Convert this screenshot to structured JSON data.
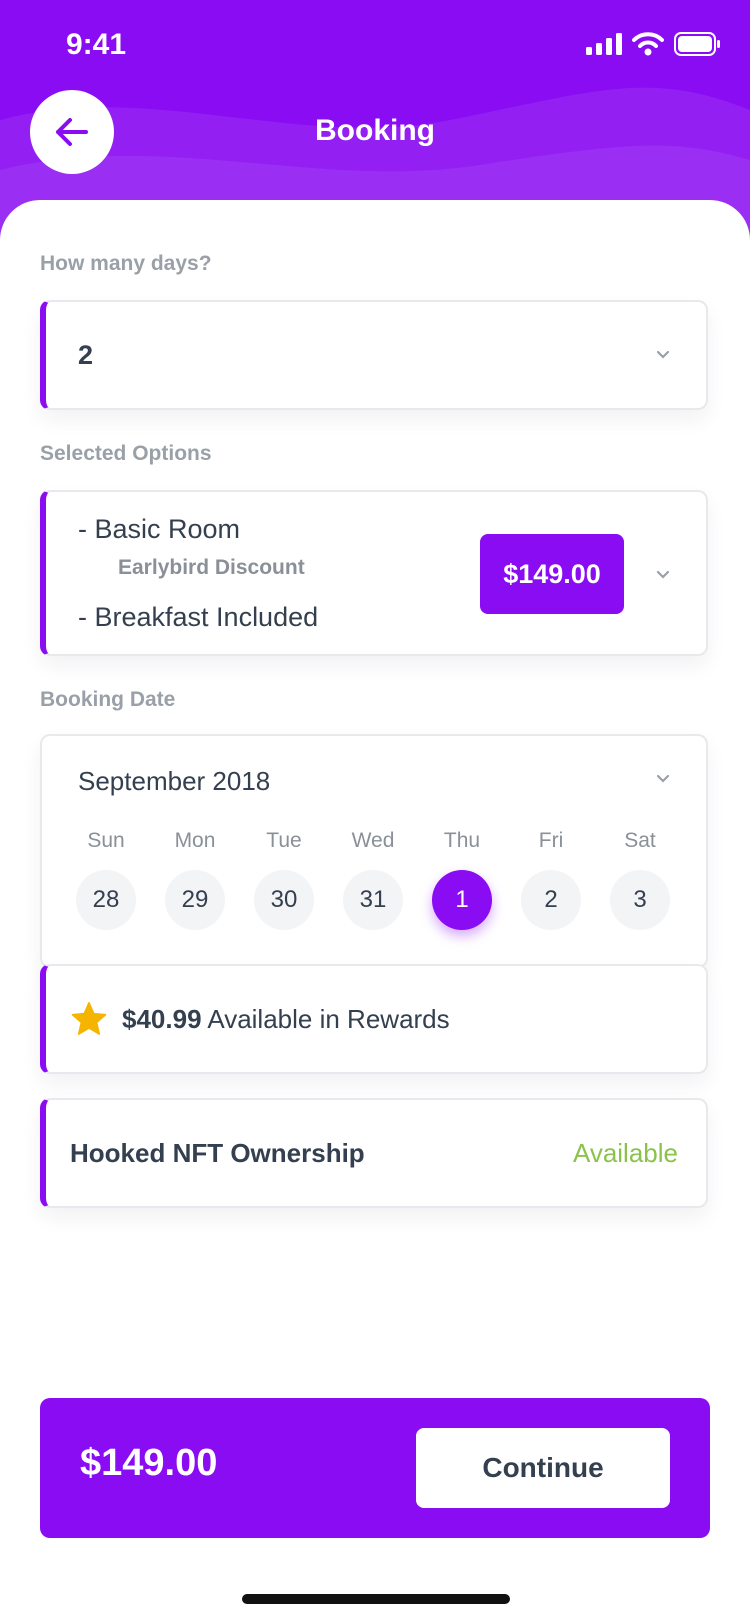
{
  "status_bar": {
    "time": "9:41",
    "icons": [
      "signal-icon",
      "wifi-icon",
      "battery-icon"
    ]
  },
  "header": {
    "title": "Booking",
    "back_icon": "arrow-left-icon"
  },
  "days": {
    "label": "How many days?",
    "value": "2"
  },
  "options": {
    "label": "Selected Options",
    "line1": "- Basic Room",
    "sub": "Earlybird Discount",
    "line2": "- Breakfast Included",
    "price": "$149.00"
  },
  "booking_date": {
    "label": "Booking Date",
    "month": "September 2018",
    "days": [
      {
        "dow": "Sun",
        "date": "28",
        "selected": false
      },
      {
        "dow": "Mon",
        "date": "29",
        "selected": false
      },
      {
        "dow": "Tue",
        "date": "30",
        "selected": false
      },
      {
        "dow": "Wed",
        "date": "31",
        "selected": false
      },
      {
        "dow": "Thu",
        "date": "1",
        "selected": true
      },
      {
        "dow": "Fri",
        "date": "2",
        "selected": false
      },
      {
        "dow": "Sat",
        "date": "3",
        "selected": false
      }
    ]
  },
  "rewards": {
    "amount": "$40.99",
    "text": "Available in Rewards"
  },
  "nft": {
    "label": "Hooked NFT Ownership",
    "status": "Available"
  },
  "footer": {
    "total": "$149.00",
    "continue_label": "Continue"
  },
  "colors": {
    "accent": "#8a0cf2",
    "available": "#8bc34a",
    "star": "#f5b400"
  }
}
